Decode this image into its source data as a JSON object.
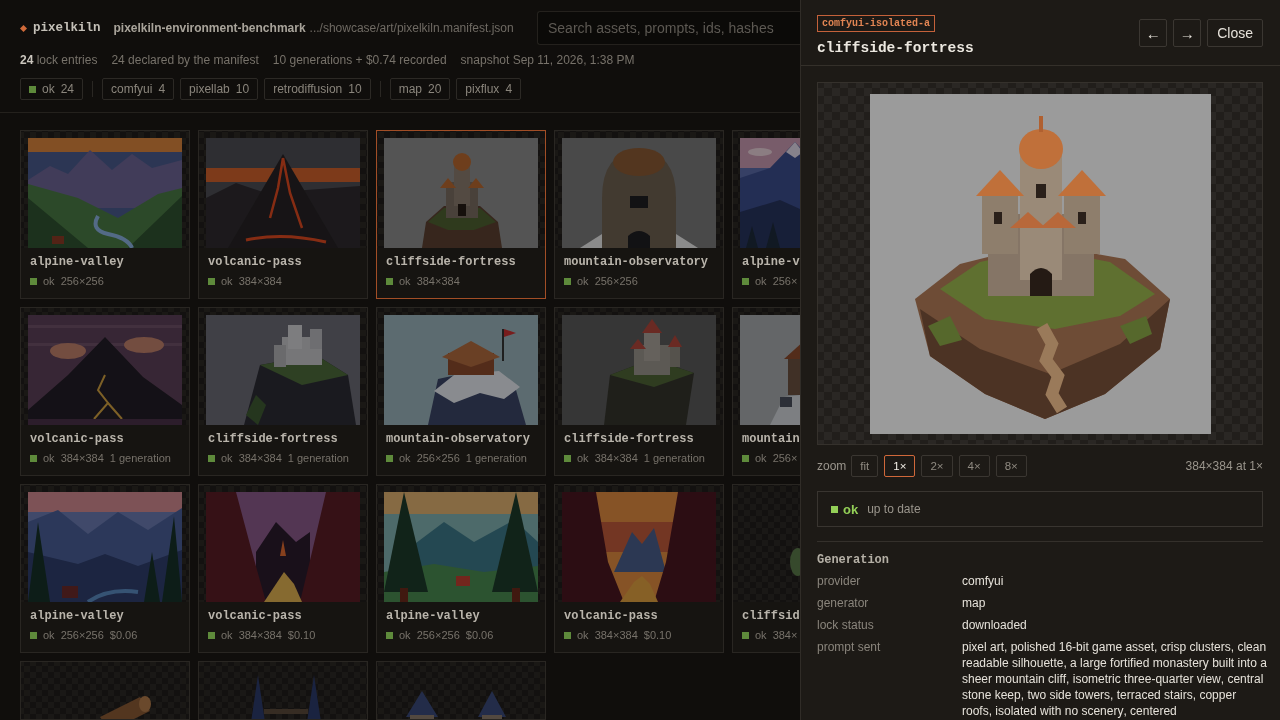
{
  "header": {
    "brand": "pixelkiln",
    "project": "pixelkiln-environment-benchmark",
    "path": ".../showcase/art/pixelkiln.manifest.json",
    "search": {
      "placeholder": "Search assets, prompts, ids, hashes"
    }
  },
  "stats": [
    "**24** lock entries",
    "24 declared by the manifest",
    "10 generations + $0.74 recorded",
    "snapshot Sep 11, 2026, 1:38 PM"
  ],
  "filter_groups": [
    [
      {
        "status": "ok",
        "count": "24"
      }
    ],
    [
      {
        "label": "comfyui",
        "count": "4"
      },
      {
        "label": "pixellab",
        "count": "10"
      },
      {
        "label": "retrodiffusion",
        "count": "10"
      }
    ],
    [
      {
        "label": "map",
        "count": "20"
      },
      {
        "label": "pixflux",
        "count": "4"
      }
    ]
  ],
  "cards": [
    {
      "title": "alpine-valley",
      "status": "ok",
      "size": "256×256",
      "kind": "valley",
      "selected": false
    },
    {
      "title": "volcanic-pass",
      "status": "ok",
      "size": "384×384",
      "kind": "volcano",
      "selected": false
    },
    {
      "title": "cliffside-fortress",
      "status": "ok",
      "size": "384×384",
      "kind": "fortress",
      "selected": true
    },
    {
      "title": "mountain-observatory",
      "status": "ok",
      "size": "256×256",
      "kind": "observatory",
      "selected": false
    },
    {
      "title": "alpine-v",
      "status": "ok",
      "size": "256×",
      "kind": "peaks",
      "selected": false
    },
    {
      "title": "volcanic-pass",
      "status": "ok",
      "size": "384×384",
      "note": "1 generation",
      "kind": "volcano-dusk",
      "selected": false
    },
    {
      "title": "cliffside-fortress",
      "status": "ok",
      "size": "384×384",
      "note": "1 generation",
      "kind": "cliff-castle",
      "selected": false
    },
    {
      "title": "mountain-observatory",
      "status": "ok",
      "size": "256×256",
      "note": "1 generation",
      "kind": "snow-hut",
      "selected": false
    },
    {
      "title": "cliffside-fortress",
      "status": "ok",
      "size": "384×384",
      "note": "1 generation",
      "kind": "tower-castle",
      "selected": false
    },
    {
      "title": "mountain",
      "status": "ok",
      "size": "256×",
      "kind": "stone-hut",
      "selected": false
    },
    {
      "title": "alpine-valley",
      "status": "ok",
      "size": "256×256",
      "note": "$0.06",
      "kind": "dusk-valley",
      "selected": false
    },
    {
      "title": "volcanic-pass",
      "status": "ok",
      "size": "384×384",
      "note": "$0.10",
      "kind": "lava-canyon",
      "selected": false
    },
    {
      "title": "alpine-valley",
      "status": "ok",
      "size": "256×256",
      "note": "$0.06",
      "kind": "forest",
      "selected": false
    },
    {
      "title": "volcanic-pass",
      "status": "ok",
      "size": "384×384",
      "note": "$0.10",
      "kind": "sunset-canyon",
      "selected": false
    },
    {
      "title": "cliffsid",
      "status": "ok",
      "size": "384×",
      "kind": "sprite",
      "selected": false
    },
    {
      "kind": "log",
      "selected": false
    },
    {
      "kind": "spires",
      "selected": false
    },
    {
      "kind": "towers",
      "selected": false
    }
  ],
  "drawer": {
    "tag": "comfyui-isolated-a",
    "title": "cliffside-fortress",
    "nav": [
      "←",
      "→"
    ],
    "close": "Close",
    "preview": {
      "kind": "fortress"
    },
    "zoom": {
      "label": "zoom",
      "options": [
        {
          "label": "fit",
          "selected": false
        },
        {
          "label": "1×",
          "selected": true
        },
        {
          "label": "2×",
          "selected": false
        },
        {
          "label": "4×",
          "selected": false
        },
        {
          "label": "8×",
          "selected": false
        }
      ],
      "info": "384×384 at 1×"
    },
    "status": {
      "status": "ok",
      "note": "up to date"
    },
    "section": {
      "title": "Generation",
      "fields": [
        {
          "label": "provider",
          "value": "comfyui"
        },
        {
          "label": "generator",
          "value": "map"
        },
        {
          "label": "lock status",
          "value": "downloaded"
        },
        {
          "label": "prompt sent",
          "value": "pixel art, polished 16-bit game asset, crisp clusters, clean readable silhouette, a large fortified monastery built into a sheer mountain cliff, isometric three-quarter view, central stone keep, two side towers, terraced stairs, copper roofs, isolated with no scenery, centered"
        }
      ]
    }
  }
}
